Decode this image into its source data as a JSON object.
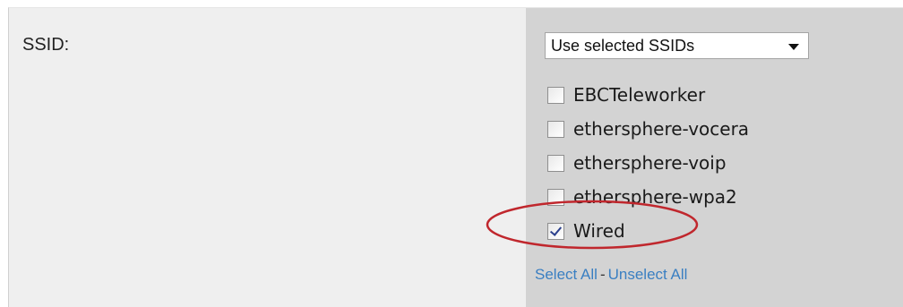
{
  "field": {
    "label": "SSID:"
  },
  "ssid_select": {
    "selected": "Use selected SSIDs"
  },
  "ssids": [
    {
      "name": "EBCTeleworker",
      "checked": false
    },
    {
      "name": "ethersphere-vocera",
      "checked": false
    },
    {
      "name": "ethersphere-voip",
      "checked": false
    },
    {
      "name": "ethersphere-wpa2",
      "checked": false
    },
    {
      "name": "Wired",
      "checked": true
    }
  ],
  "actions": {
    "select_all": "Select All",
    "separator": "-",
    "unselect_all": "Unselect All"
  },
  "colors": {
    "label_bg": "#efefef",
    "value_bg": "#d3d3d3",
    "link": "#3a7fc2",
    "annotation": "#c0272d"
  }
}
